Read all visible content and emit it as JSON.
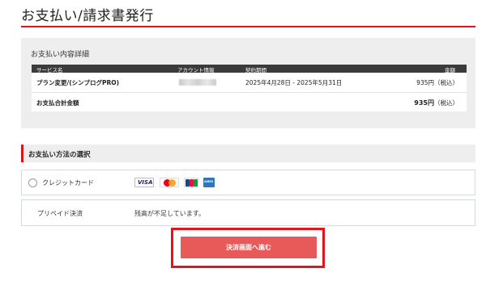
{
  "page": {
    "title": "お支払い/請求書発行"
  },
  "detail": {
    "heading": "お支払い内容詳細",
    "columns": {
      "service": "サービス名",
      "account": "アカウント情報",
      "period": "契約期間",
      "amount": "金額"
    },
    "rows": [
      {
        "service": "プラン変更/(シンプログPRO)",
        "period": "2025年4月28日 - 2025年5月31日",
        "amount": "935円",
        "tax": "（税込）"
      }
    ],
    "total": {
      "label": "お支払合計金額",
      "amount": "935円",
      "tax": "（税込）"
    }
  },
  "method": {
    "heading": "お支払い方法の選択",
    "credit": {
      "label": "クレジットカード",
      "selected": false,
      "cards": [
        "visa-icon",
        "mastercard-icon",
        "jcb-icon",
        "amex-icon"
      ],
      "visa_text": "VISA",
      "amex_text": "AMEX"
    },
    "prepaid": {
      "label": "プリペイド決済",
      "status": "残高が不足しています。"
    }
  },
  "action": {
    "submit_label": "決済画面へ進む"
  },
  "colors": {
    "accent": "#d0191f",
    "button": "#e85a5a",
    "highlight": "#e4141c"
  }
}
